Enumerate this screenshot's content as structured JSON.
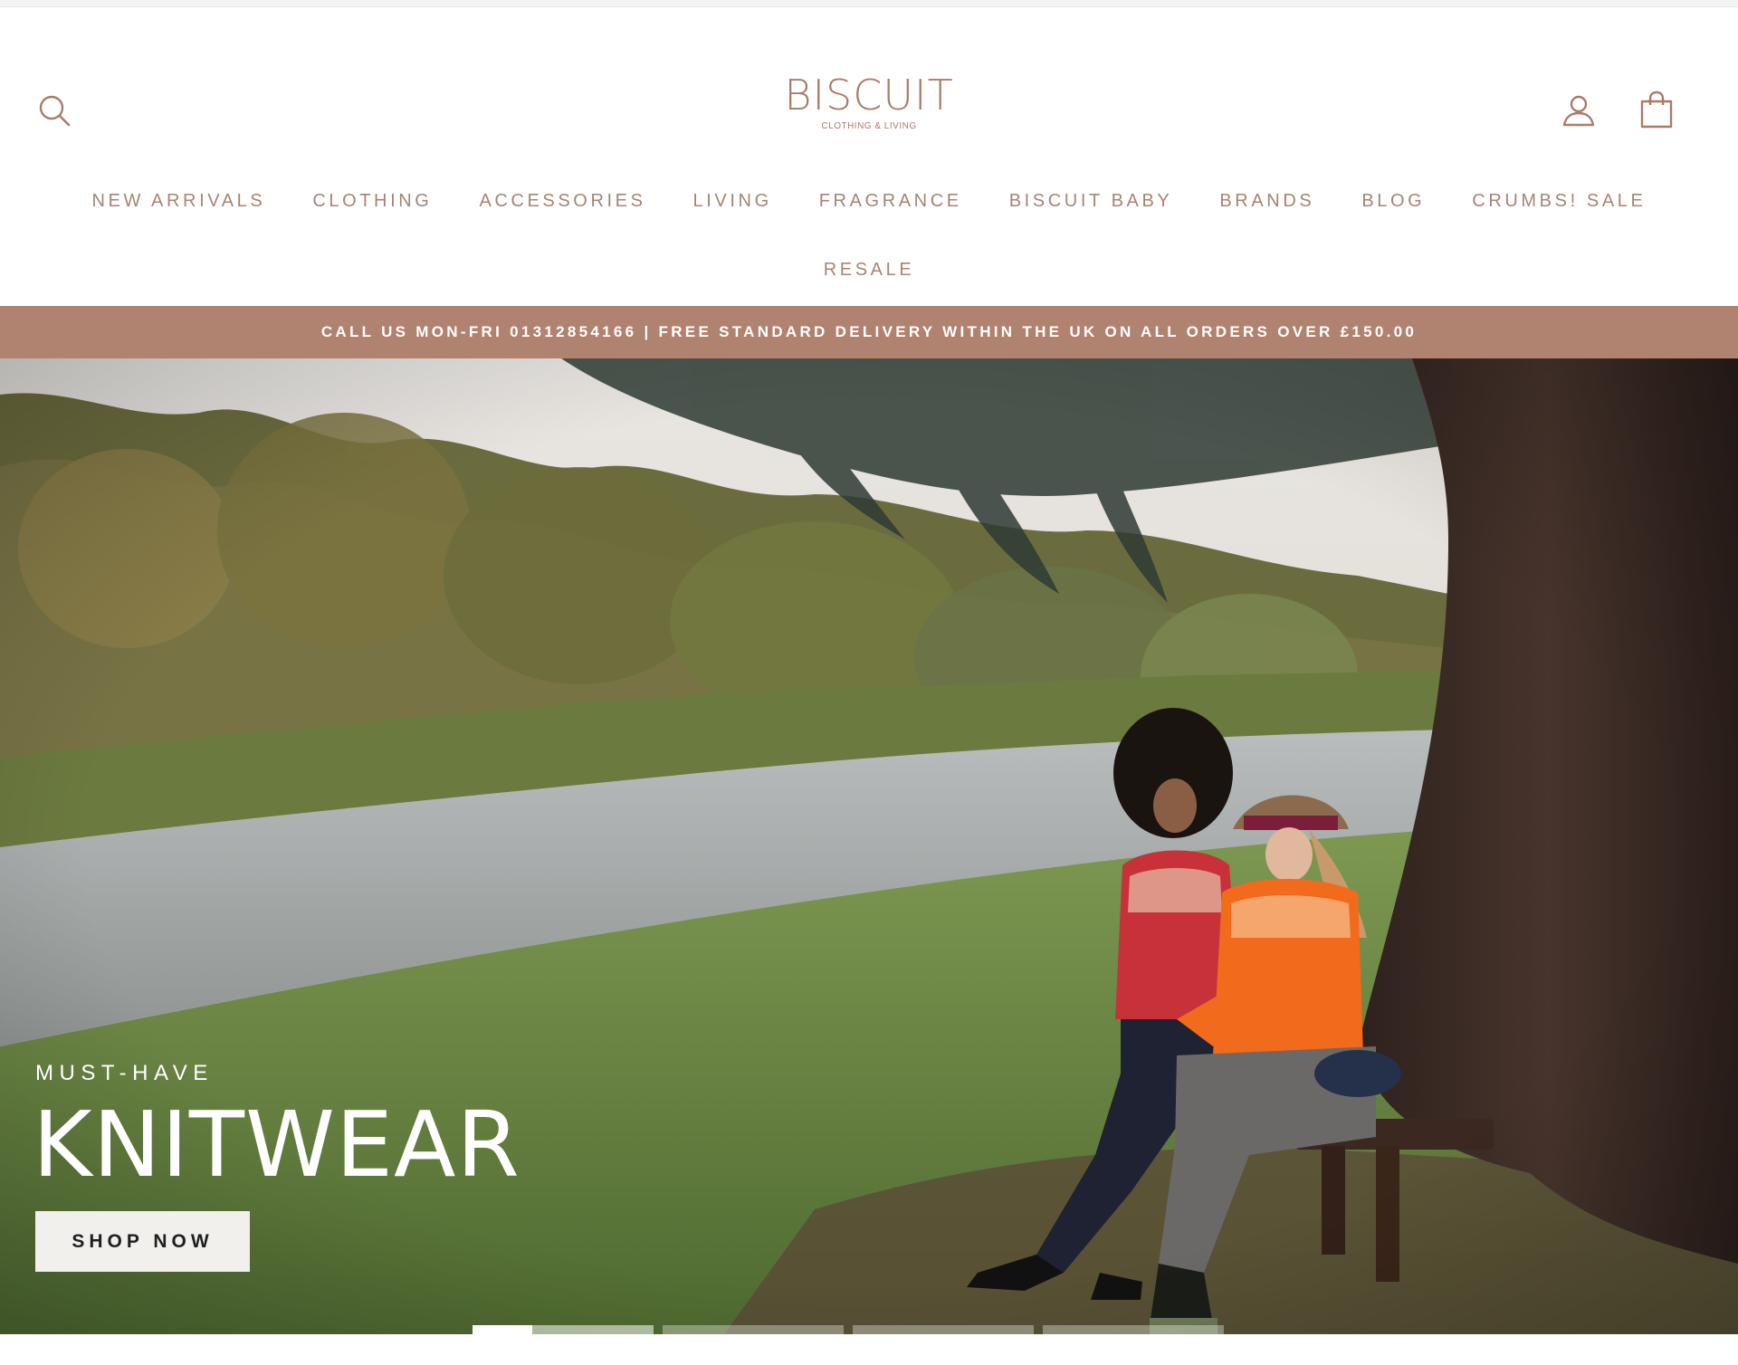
{
  "brand": {
    "name": "BISCUIT",
    "tagline": "CLOTHING & LIVING",
    "accent_color": "#a97c69",
    "banner_color": "#b08371"
  },
  "header": {
    "icons": {
      "search": "search-icon",
      "account": "account-icon",
      "cart": "cart-icon"
    }
  },
  "nav": {
    "items": [
      "NEW ARRIVALS",
      "CLOTHING",
      "ACCESSORIES",
      "LIVING",
      "FRAGRANCE",
      "BISCUIT BABY",
      "BRANDS",
      "BLOG",
      "CRUMBS! SALE",
      "RESALE"
    ]
  },
  "announcement": {
    "text": "CALL US MON-FRI 01312854166 | FREE STANDARD DELIVERY WITHIN THE UK ON ALL ORDERS OVER £150.00"
  },
  "hero": {
    "eyebrow": "MUST-HAVE",
    "title": "KNITWEAR",
    "button_label": "SHOP NOW",
    "slides_total": 4,
    "active_slide": 1,
    "active_slide_progress": 0.33
  }
}
